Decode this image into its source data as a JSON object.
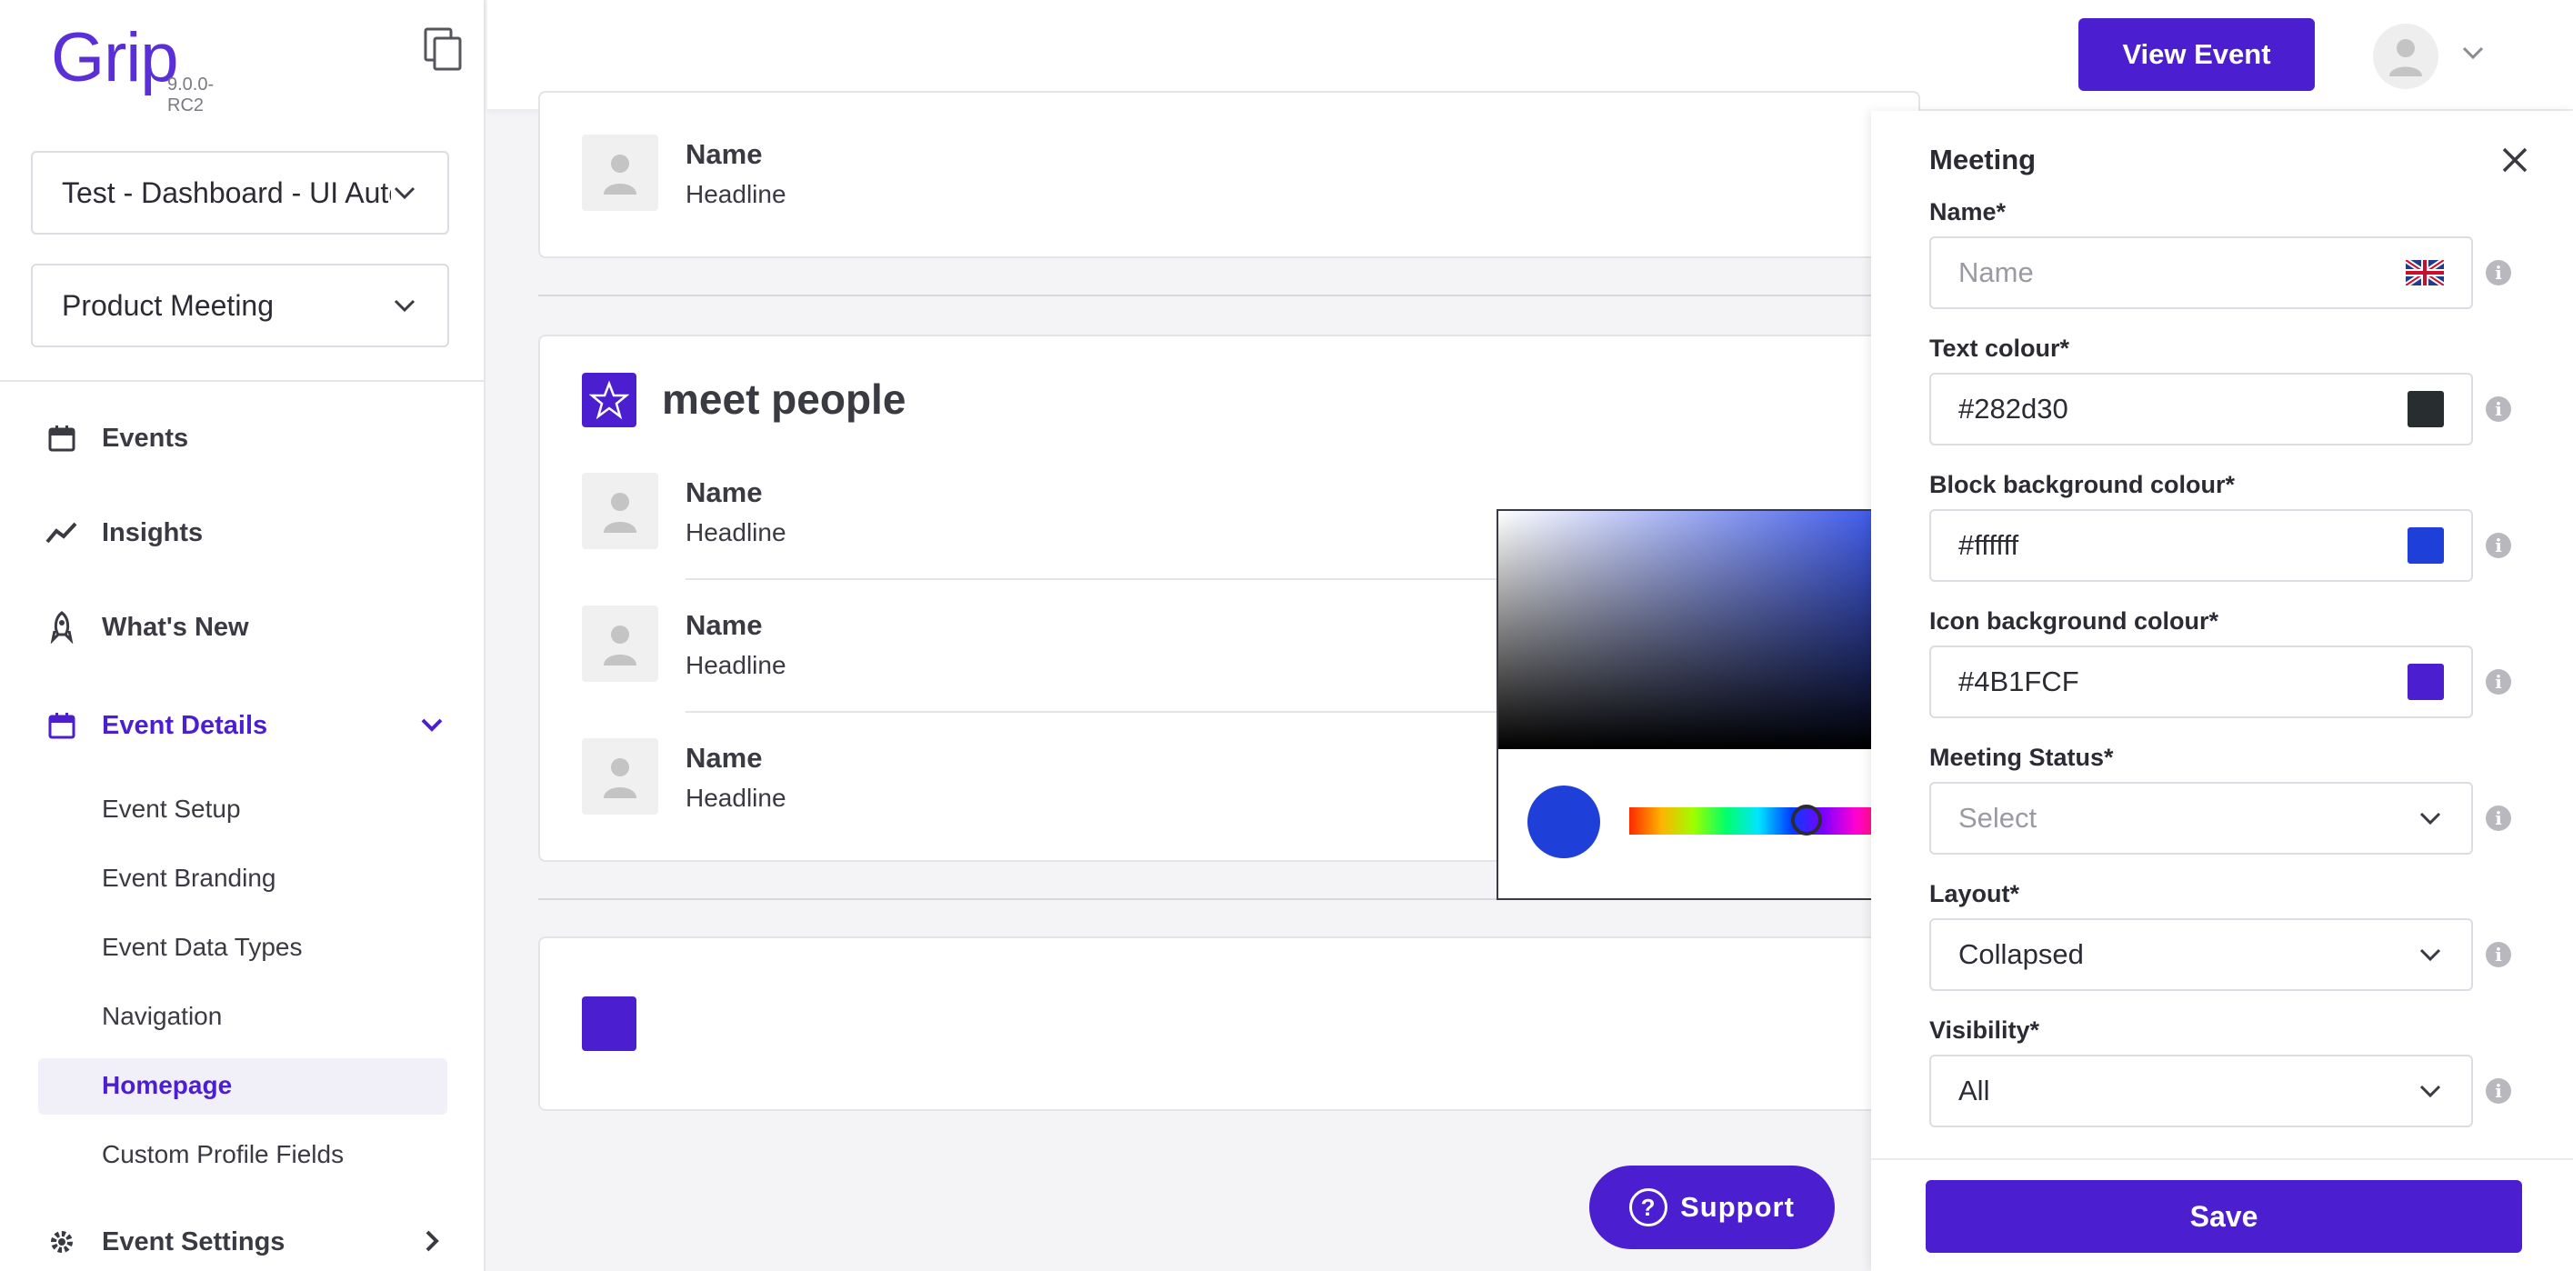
{
  "brand": {
    "name": "Grip",
    "version": "9.0.0-RC2",
    "accent": "#4b1fcf"
  },
  "sidebar": {
    "event_select": "Test - Dashboard - UI Automation",
    "meeting_select": "Product Meeting",
    "nav": [
      {
        "label": "Events",
        "icon": "calendar-icon"
      },
      {
        "label": "Insights",
        "icon": "trend-icon"
      },
      {
        "label": "What's New",
        "icon": "rocket-icon"
      },
      {
        "label": "Event Details",
        "icon": "calendar-icon",
        "expanded": true
      },
      {
        "label": "Event Settings",
        "icon": "gear-icon"
      }
    ],
    "sub_items": [
      "Event Setup",
      "Event Branding",
      "Event Data Types",
      "Navigation",
      "Homepage",
      "Custom Profile Fields"
    ],
    "active_sub": "Homepage"
  },
  "topbar": {
    "view_event_label": "View Event"
  },
  "main": {
    "card1_person": {
      "name": "Name",
      "headline": "Headline"
    },
    "section_title": "meet people",
    "people": [
      {
        "name": "Name",
        "headline": "Headline"
      },
      {
        "name": "Name",
        "headline": "Headline"
      },
      {
        "name": "Name",
        "headline": "Headline"
      }
    ]
  },
  "picker": {
    "current_color": "#1f3fd9"
  },
  "panel": {
    "title": "Meeting",
    "fields": {
      "name": {
        "label": "Name*",
        "placeholder": "Name",
        "value": ""
      },
      "text_colour": {
        "label": "Text colour*",
        "value": "#282d30",
        "swatch": "#282d30"
      },
      "block_bg": {
        "label": "Block background colour*",
        "value": "#ffffff",
        "swatch": "#1f3fd9"
      },
      "icon_bg": {
        "label": "Icon background colour*",
        "value": "#4B1FCF",
        "swatch": "#4b1fcf"
      },
      "status": {
        "label": "Meeting Status*",
        "placeholder": "Select"
      },
      "layout": {
        "label": "Layout*",
        "value": "Collapsed"
      },
      "visibility": {
        "label": "Visibility*",
        "value": "All"
      }
    },
    "save_label": "Save"
  },
  "support": {
    "label": "Support"
  }
}
